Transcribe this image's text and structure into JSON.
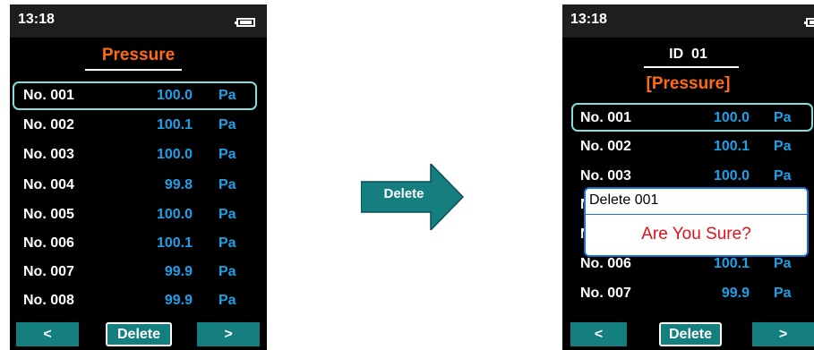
{
  "left_screen": {
    "time": "13:18",
    "title": "Pressure",
    "rows": [
      {
        "no": "No. 001",
        "value": "100.0",
        "unit": "Pa"
      },
      {
        "no": "No. 002",
        "value": "100.1",
        "unit": "Pa"
      },
      {
        "no": "No. 003",
        "value": "100.0",
        "unit": "Pa"
      },
      {
        "no": "No. 004",
        "value": "99.8",
        "unit": "Pa"
      },
      {
        "no": "No. 005",
        "value": "100.0",
        "unit": "Pa"
      },
      {
        "no": "No. 006",
        "value": "100.1",
        "unit": "Pa"
      },
      {
        "no": "No. 007",
        "value": "99.9",
        "unit": "Pa"
      },
      {
        "no": "No. 008",
        "value": "99.9",
        "unit": "Pa"
      }
    ],
    "buttons": {
      "prev": "<",
      "delete": "Delete",
      "next": ">"
    }
  },
  "arrow": {
    "label": "Delete",
    "color": "#157f80"
  },
  "right_screen": {
    "time": "13:18",
    "id_label": "ID  01",
    "title": "[Pressure]",
    "rows": [
      {
        "no": "No. 001",
        "value": "100.0",
        "unit": "Pa"
      },
      {
        "no": "No. 002",
        "value": "100.1",
        "unit": "Pa"
      },
      {
        "no": "No. 003",
        "value": "100.0",
        "unit": "Pa"
      },
      {
        "no": "N",
        "value": "",
        "unit": ""
      },
      {
        "no": "N",
        "value": "",
        "unit": ""
      },
      {
        "no": "No. 006",
        "value": "100.1",
        "unit": "Pa"
      },
      {
        "no": "No. 007",
        "value": "99.9",
        "unit": "Pa"
      }
    ],
    "dialog": {
      "title": "Delete 001",
      "message": "Are You Sure?"
    },
    "buttons": {
      "prev": "<",
      "delete": "Delete",
      "next": ">"
    }
  },
  "colors": {
    "accent_orange": "#ff6a13",
    "value_blue": "#1ea0e8",
    "button_teal": "#157f80",
    "selection": "#7fe0dc"
  }
}
